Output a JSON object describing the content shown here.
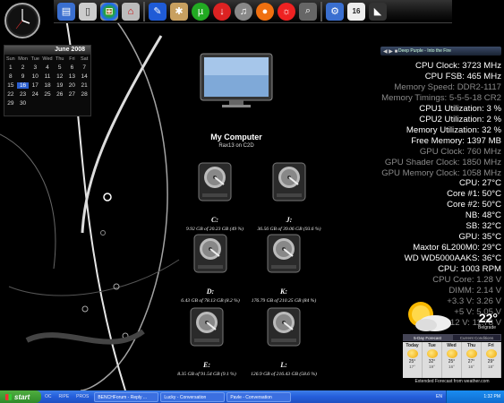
{
  "calendar": {
    "month_year": "June 2008",
    "days_of_week": [
      "Sun",
      "Mon",
      "Tue",
      "Wed",
      "Thu",
      "Fri",
      "Sat"
    ],
    "weeks": [
      [
        "1",
        "2",
        "3",
        "4",
        "5",
        "6",
        "7"
      ],
      [
        "8",
        "9",
        "10",
        "11",
        "12",
        "13",
        "14"
      ],
      [
        "15",
        "16",
        "17",
        "18",
        "19",
        "20",
        "21"
      ],
      [
        "22",
        "23",
        "24",
        "25",
        "26",
        "27",
        "28"
      ],
      [
        "29",
        "30",
        "",
        "",
        "",
        "",
        ""
      ]
    ],
    "today": "16"
  },
  "media_bar": {
    "text": "Deep Purple - Into the Fire"
  },
  "sysmon": [
    {
      "text": "CPU Clock: 3723 MHz",
      "style": "w"
    },
    {
      "text": "CPU FSB: 465 MHz",
      "style": "w"
    },
    {
      "text": "Memory Speed: DDR2-1117",
      "style": "g"
    },
    {
      "text": "Memory Timings: 5-5-5-18 CR2",
      "style": "g"
    },
    {
      "text": "CPU1 Utilization: 3 %",
      "style": "w"
    },
    {
      "text": "CPU2 Utilization: 2 %",
      "style": "w"
    },
    {
      "text": "Memory Utilization: 32 %",
      "style": "w"
    },
    {
      "text": "Free Memory: 1397 MB",
      "style": "w"
    },
    {
      "text": "GPU Clock: 760 MHz",
      "style": "g"
    },
    {
      "text": "GPU Shader Clock: 1850 MHz",
      "style": "g"
    },
    {
      "text": "GPU Memory Clock: 1058 MHz",
      "style": "g"
    },
    {
      "text": "CPU: 27°C",
      "style": "w"
    },
    {
      "text": "Core #1: 50°C",
      "style": "w"
    },
    {
      "text": "Core #2: 50°C",
      "style": "w"
    },
    {
      "text": "NB: 48°C",
      "style": "w"
    },
    {
      "text": "SB: 32°C",
      "style": "w"
    },
    {
      "text": "GPU: 35°C",
      "style": "w"
    },
    {
      "text": "Maxtor 6L200M0: 29°C",
      "style": "w"
    },
    {
      "text": "WD WD5000AAKS: 36°C",
      "style": "w"
    },
    {
      "text": "CPU: 1003 RPM",
      "style": "w"
    },
    {
      "text": "CPU Core: 1.28 V",
      "style": "g"
    },
    {
      "text": "DIMM: 2.14 V",
      "style": "g"
    },
    {
      "text": "+3.3 V: 3.26 V",
      "style": "g"
    },
    {
      "text": "+5 V: 5.05 V",
      "style": "g"
    },
    {
      "text": "+12 V: 11.78 V",
      "style": "g"
    }
  ],
  "my_computer": {
    "title": "My Computer",
    "subtitle": "Rax13 on C2D"
  },
  "drives": [
    {
      "letter": "C:",
      "info": "9.92 GB of 20.23 GB (49 %)"
    },
    {
      "letter": "J:",
      "info": "36.56 GB of 39.06 GB (93.6 %)"
    },
    {
      "letter": "D:",
      "info": "6.43 GB of 78.13 GB (8.2 %)"
    },
    {
      "letter": "K:",
      "info": "176.79 GB of 210.25 GB (84 %)"
    },
    {
      "letter": "E:",
      "info": "8.35 GB of 91.54 GB (9.1 %)"
    },
    {
      "letter": "L:",
      "info": "126.9 GB of 216.43 GB (58.6 %)"
    }
  ],
  "weather": {
    "temp": "22°",
    "city": "Belgrade",
    "tabs": [
      "5-Day Forecast",
      "Current Conditions"
    ],
    "days": [
      {
        "name": "Today",
        "hi": "25°",
        "lo": "17°"
      },
      {
        "name": "Tue",
        "hi": "32°",
        "lo": "19°"
      },
      {
        "name": "Wed",
        "hi": "25°",
        "lo": "16°"
      },
      {
        "name": "Thu",
        "hi": "27°",
        "lo": "16°"
      },
      {
        "name": "Fri",
        "hi": "29°",
        "lo": "18°"
      }
    ],
    "footer": "Extended Forecast from weather.com"
  },
  "taskbar": {
    "start": "start",
    "quicklaunch": [
      "OC",
      "RIPE",
      "PROS"
    ],
    "tasks": [
      "BENCHForum - Reply ...",
      "Lucky - Conversation",
      "Pavle - Conversation"
    ],
    "lang": "EN",
    "time": "1:32 PM"
  },
  "colors": {
    "taskbar": "#245edb",
    "start": "#3c9a34",
    "today": "#2b5fd0",
    "dim_text": "#8a8a8a"
  }
}
